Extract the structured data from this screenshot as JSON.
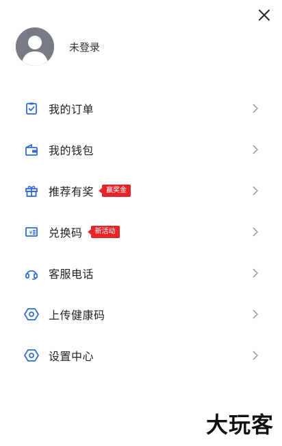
{
  "close": {
    "icon": "close-icon"
  },
  "profile": {
    "name": "未登录",
    "avatar_icon": "avatar-placeholder-icon"
  },
  "menu": {
    "items": [
      {
        "label": "我的订单",
        "icon": "order-clipboard-icon"
      },
      {
        "label": "我的钱包",
        "icon": "wallet-icon"
      },
      {
        "label": "推荐有奖",
        "icon": "gift-icon",
        "tag": "赢奖金"
      },
      {
        "label": "兑换码",
        "icon": "coupon-icon",
        "tag": "新活动"
      },
      {
        "label": "客服电话",
        "icon": "headset-icon"
      },
      {
        "label": "上传健康码",
        "icon": "hexagon-eye-icon"
      },
      {
        "label": "设置中心",
        "icon": "settings-hexagon-icon"
      }
    ]
  },
  "brand": {
    "text": "大玩客"
  },
  "colors": {
    "accent": "#2f6bd8",
    "tag": "#e8242b",
    "chevron": "#9a9a9a"
  }
}
